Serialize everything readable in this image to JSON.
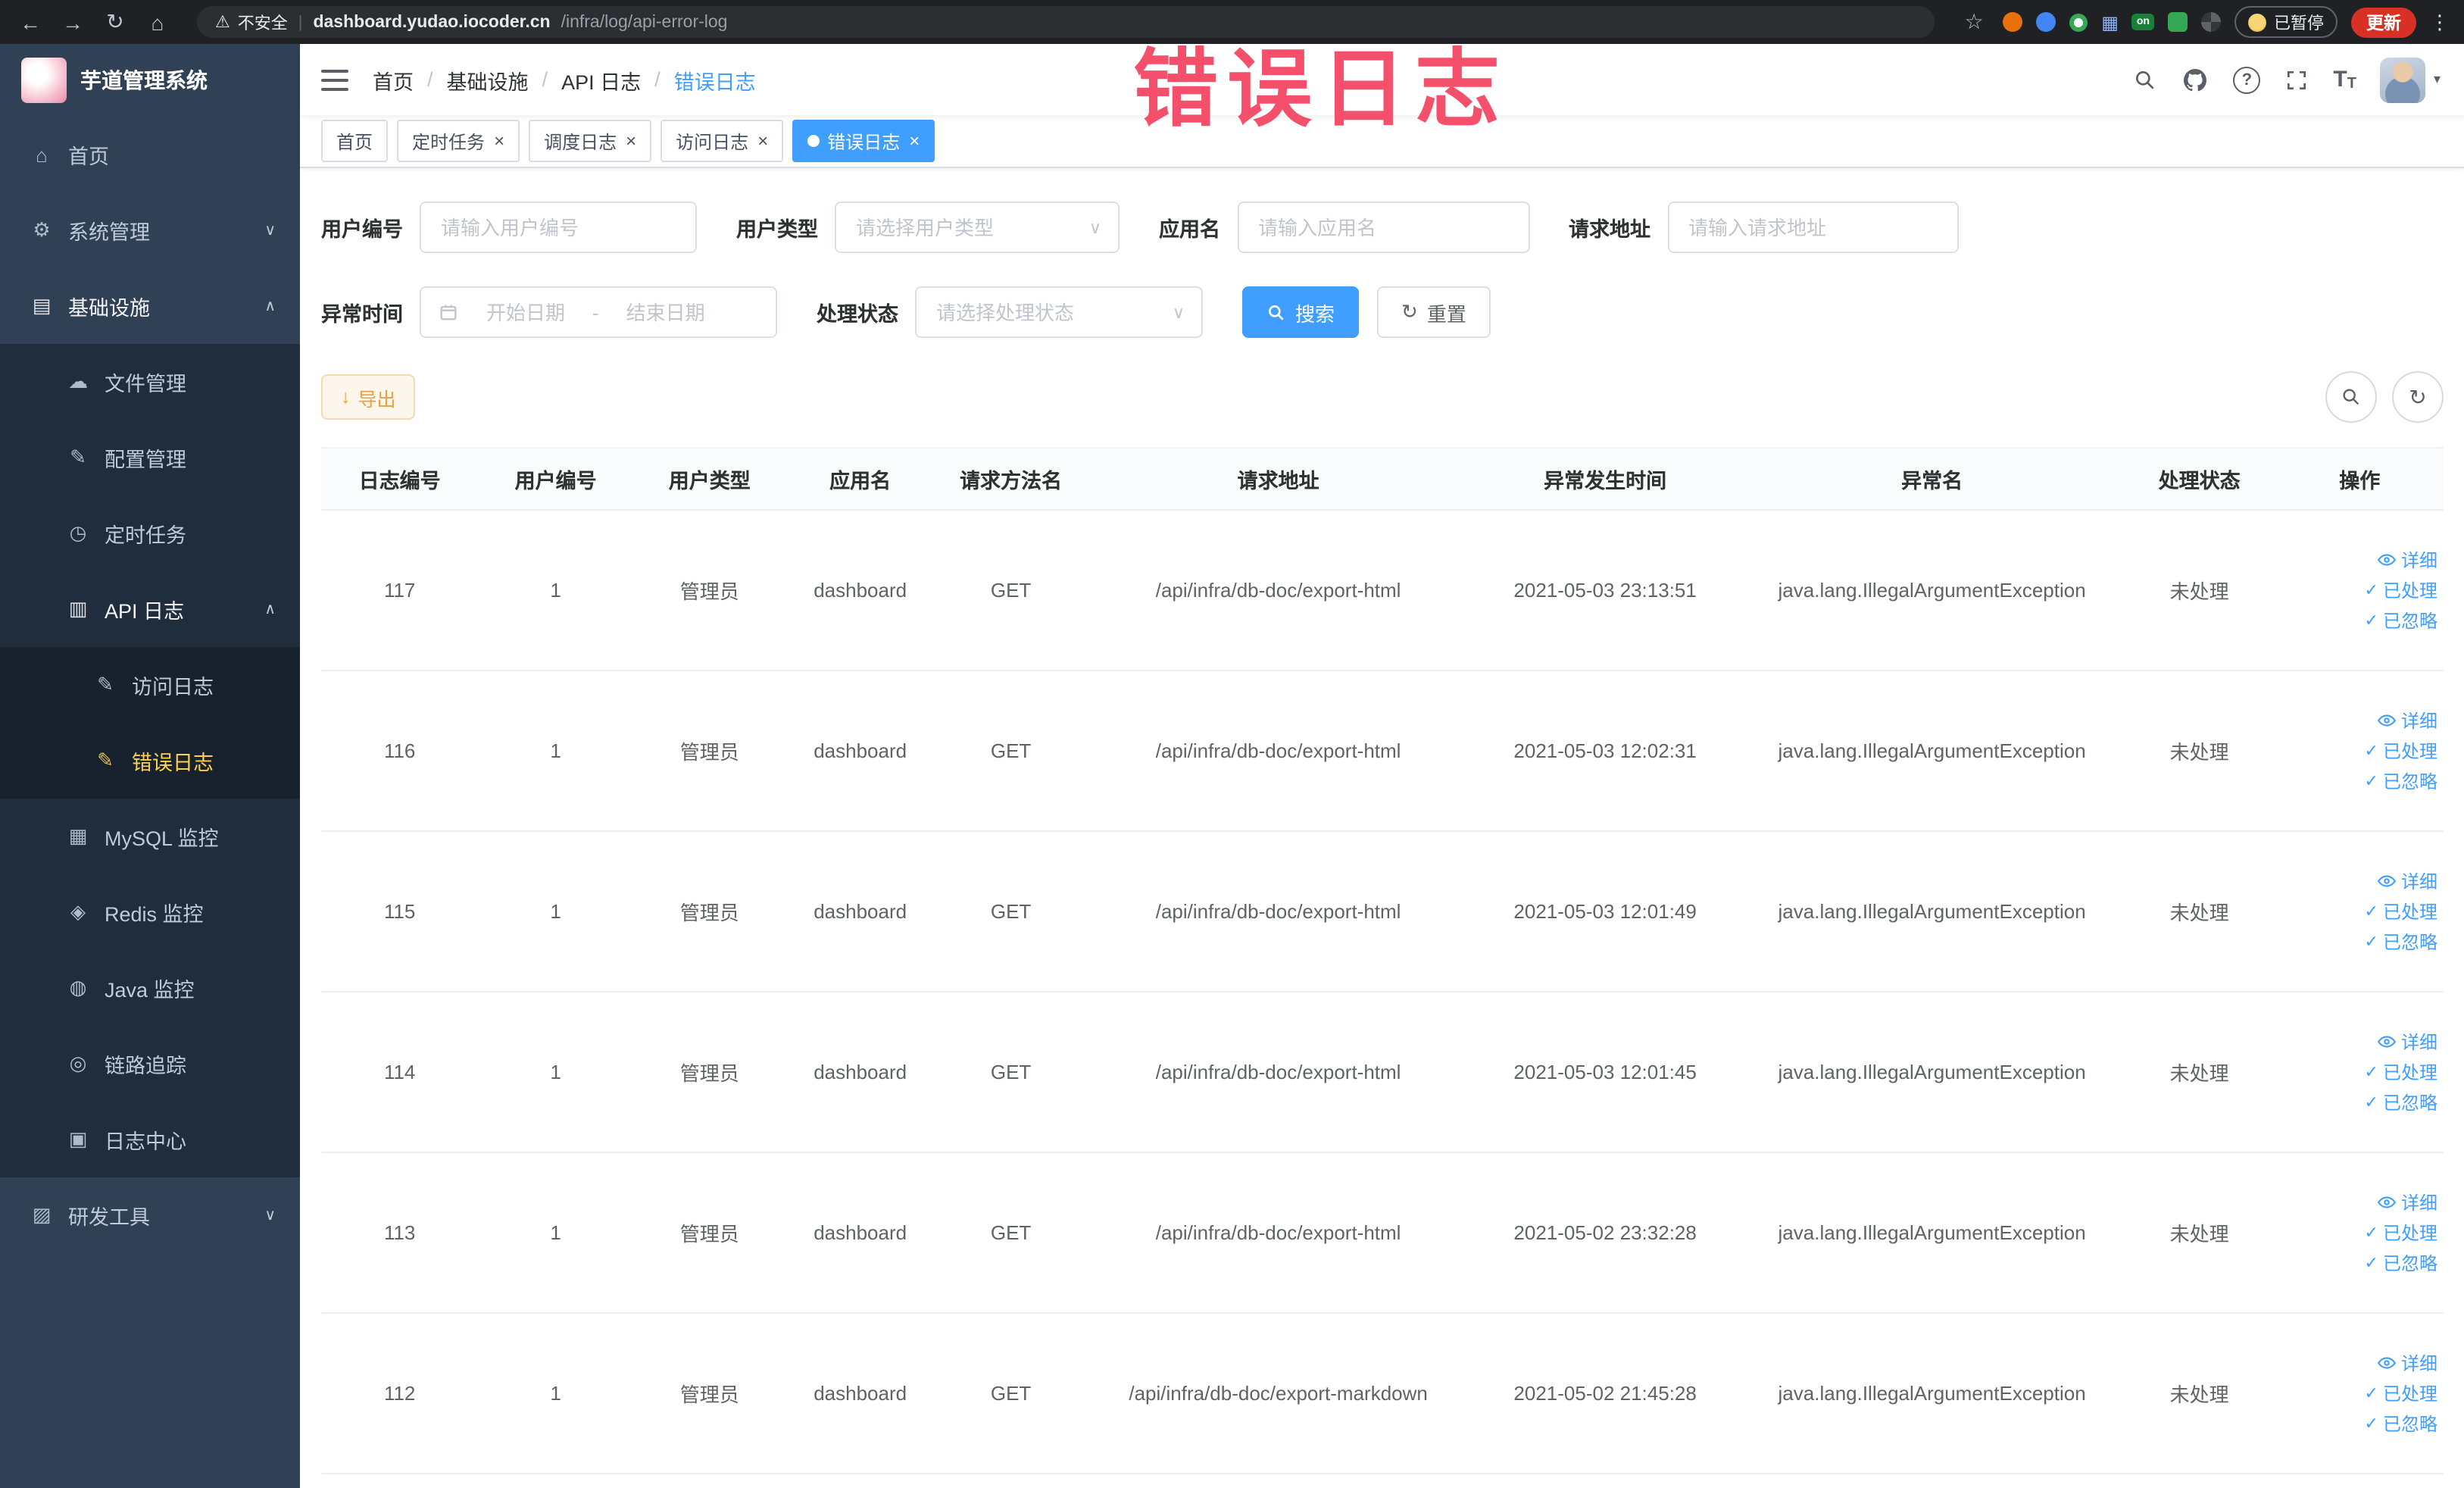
{
  "browser": {
    "security_label": "不安全",
    "url_host": "dashboard.yudao.iocoder.cn",
    "url_path": "/infra/log/api-error-log",
    "extension_on_badge": "on",
    "paused_badge": "已暂停",
    "update_button": "更新"
  },
  "annotation": {
    "watermark": "错误日志"
  },
  "sidebar": {
    "logo_title": "芋道管理系统",
    "home": "首页",
    "system_mgmt": "系统管理",
    "infrastructure": "基础设施",
    "file_mgmt": "文件管理",
    "config_mgmt": "配置管理",
    "scheduled_jobs": "定时任务",
    "api_log": "API 日志",
    "access_log": "访问日志",
    "error_log": "错误日志",
    "mysql_monitor": "MySQL 监控",
    "redis_monitor": "Redis 监控",
    "java_monitor": "Java 监控",
    "tracing": "链路追踪",
    "log_center": "日志中心",
    "dev_tools": "研发工具"
  },
  "breadcrumb": [
    "首页",
    "基础设施",
    "API 日志",
    "错误日志"
  ],
  "tabs": [
    {
      "label": "首页"
    },
    {
      "label": "定时任务"
    },
    {
      "label": "调度日志"
    },
    {
      "label": "访问日志"
    },
    {
      "label": "错误日志"
    }
  ],
  "filters": {
    "user_id_label": "用户编号",
    "user_id_placeholder": "请输入用户编号",
    "user_type_label": "用户类型",
    "user_type_placeholder": "请选择用户类型",
    "app_name_label": "应用名",
    "app_name_placeholder": "请输入应用名",
    "request_url_label": "请求地址",
    "request_url_placeholder": "请输入请求地址",
    "exception_time_label": "异常时间",
    "start_date_placeholder": "开始日期",
    "date_separator": "-",
    "end_date_placeholder": "结束日期",
    "process_status_label": "处理状态",
    "process_status_placeholder": "请选择处理状态",
    "search_button": "搜索",
    "reset_button": "重置"
  },
  "toolbar": {
    "export_button": "导出"
  },
  "table": {
    "columns": [
      "日志编号",
      "用户编号",
      "用户类型",
      "应用名",
      "请求方法名",
      "请求地址",
      "异常发生时间",
      "异常名",
      "处理状态",
      "操作"
    ],
    "actions": {
      "detail": "详细",
      "processed": "已处理",
      "ignored": "已忽略"
    },
    "rows": [
      {
        "id": "117",
        "user_id": "1",
        "user_type": "管理员",
        "app": "dashboard",
        "method": "GET",
        "url": "/api/infra/db-doc/export-html",
        "time": "2021-05-03 23:13:51",
        "exception": "java.lang.IllegalArgumentException",
        "status": "未处理"
      },
      {
        "id": "116",
        "user_id": "1",
        "user_type": "管理员",
        "app": "dashboard",
        "method": "GET",
        "url": "/api/infra/db-doc/export-html",
        "time": "2021-05-03 12:02:31",
        "exception": "java.lang.IllegalArgumentException",
        "status": "未处理"
      },
      {
        "id": "115",
        "user_id": "1",
        "user_type": "管理员",
        "app": "dashboard",
        "method": "GET",
        "url": "/api/infra/db-doc/export-html",
        "time": "2021-05-03 12:01:49",
        "exception": "java.lang.IllegalArgumentException",
        "status": "未处理"
      },
      {
        "id": "114",
        "user_id": "1",
        "user_type": "管理员",
        "app": "dashboard",
        "method": "GET",
        "url": "/api/infra/db-doc/export-html",
        "time": "2021-05-03 12:01:45",
        "exception": "java.lang.IllegalArgumentException",
        "status": "未处理"
      },
      {
        "id": "113",
        "user_id": "1",
        "user_type": "管理员",
        "app": "dashboard",
        "method": "GET",
        "url": "/api/infra/db-doc/export-html",
        "time": "2021-05-02 23:32:28",
        "exception": "java.lang.IllegalArgumentException",
        "status": "未处理"
      },
      {
        "id": "112",
        "user_id": "1",
        "user_type": "管理员",
        "app": "dashboard",
        "method": "GET",
        "url": "/api/infra/db-doc/export-markdown",
        "time": "2021-05-02 21:45:28",
        "exception": "java.lang.IllegalArgumentException",
        "status": "未处理"
      }
    ]
  }
}
